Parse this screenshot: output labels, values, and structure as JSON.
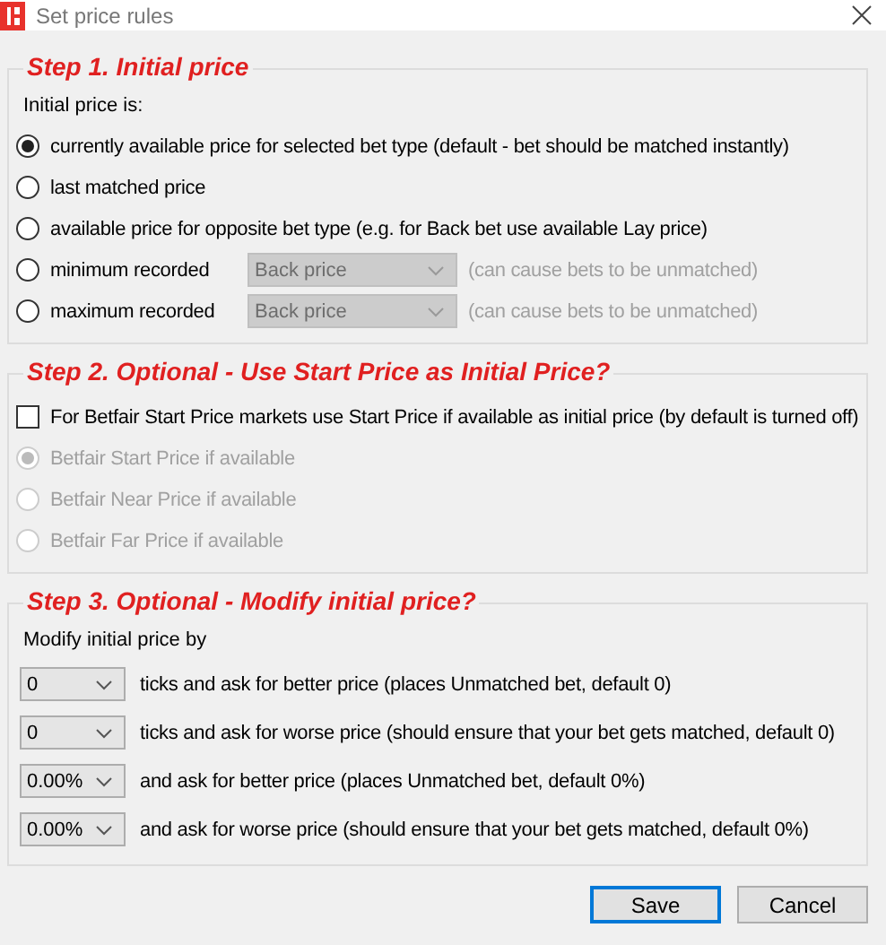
{
  "window": {
    "title": "Set price rules"
  },
  "step1": {
    "title": "Step 1. Initial price",
    "label": "Initial price is:",
    "options": [
      {
        "kind": "radio",
        "label": "currently available price for selected bet type (default - bet should be matched instantly)",
        "selected": true
      },
      {
        "kind": "radio",
        "label": "last matched price",
        "selected": false
      },
      {
        "kind": "radio",
        "label": "available price for opposite bet type (e.g. for Back bet use available Lay price)",
        "selected": false
      },
      {
        "kind": "radio_dropdown",
        "label": "minimum recorded",
        "selected": false,
        "dropdown": {
          "value": "Back price",
          "disabled": true
        },
        "note": "(can cause bets to be unmatched)"
      },
      {
        "kind": "radio_dropdown",
        "label": "maximum recorded",
        "selected": false,
        "dropdown": {
          "value": "Back price",
          "disabled": true
        },
        "note": "(can cause bets to be unmatched)"
      }
    ]
  },
  "step2": {
    "title": "Step 2. Optional - Use Start Price as Initial Price?",
    "checkbox": {
      "label": "For Betfair Start Price markets use Start Price if available as initial price (by default is turned off)",
      "checked": false
    },
    "options": [
      {
        "label": "Betfair Start Price if available",
        "selected": true,
        "disabled": true
      },
      {
        "label": "Betfair Near Price if available",
        "selected": false,
        "disabled": true
      },
      {
        "label": "Betfair Far Price if available",
        "selected": false,
        "disabled": true
      }
    ]
  },
  "step3": {
    "title": "Step 3. Optional - Modify initial price?",
    "label": "Modify initial price by",
    "rows": [
      {
        "value": "0",
        "text": "ticks and ask for better price (places Unmatched bet, default 0)"
      },
      {
        "value": "0",
        "text": "ticks and ask for worse price (should ensure that your bet gets matched, default 0)"
      },
      {
        "value": "0.00%",
        "text": "and ask for better price (places Unmatched bet, default 0%)"
      },
      {
        "value": "0.00%",
        "text": "and ask for worse price (should ensure that your bet gets matched, default 0%)"
      }
    ]
  },
  "buttons": [
    {
      "label": "Save",
      "default": true
    },
    {
      "label": "Cancel",
      "default": false
    }
  ]
}
